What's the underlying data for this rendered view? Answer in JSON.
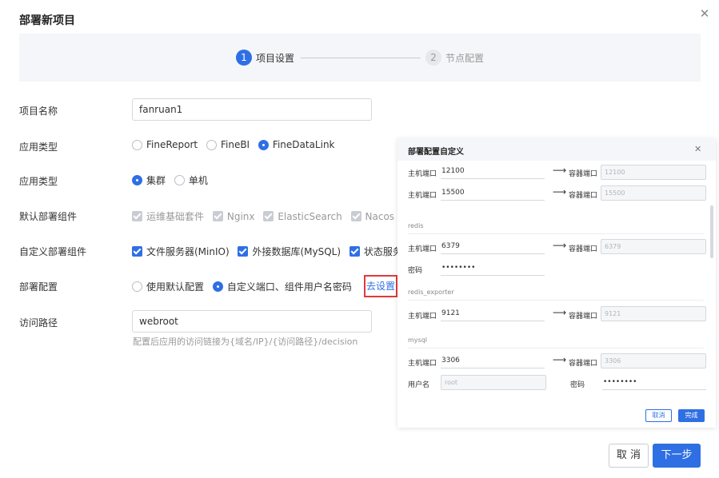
{
  "dialog": {
    "title": "部署新项目"
  },
  "steps": [
    {
      "num": "1",
      "label": "项目设置"
    },
    {
      "num": "2",
      "label": "节点配置"
    }
  ],
  "form": {
    "project_name": {
      "label": "项目名称",
      "value": "fanruan1"
    },
    "app_type": {
      "label": "应用类型",
      "options": [
        "FineReport",
        "FineBI",
        "FineDataLink"
      ],
      "selected": "FineDataLink"
    },
    "deploy_mode": {
      "label": "应用类型",
      "options": [
        "集群",
        "单机"
      ],
      "selected": "集群"
    },
    "default_components": {
      "label": "默认部署组件",
      "options": [
        "运维基础套件",
        "Nginx",
        "ElasticSearch",
        "Nacos"
      ]
    },
    "custom_components": {
      "label": "自定义部署组件",
      "options": [
        "文件服务器(MinIO)",
        "外接数据库(MySQL)",
        "状态服务器"
      ]
    },
    "deploy_config": {
      "label": "部署配置",
      "options": [
        "使用默认配置",
        "自定义端口、组件用户名密码"
      ],
      "selected": "自定义端口、组件用户名密码",
      "link": "去设置"
    },
    "access_path": {
      "label": "访问路径",
      "value": "webroot",
      "hint": "配置后应用的访问链接为{域名/IP}/{访问路径}/decision"
    }
  },
  "panel": {
    "title": "部署配置自定义",
    "host_port_label": "主机端口",
    "container_port_label": "容器端口",
    "rows1": [
      {
        "host": "12100",
        "container": "12100"
      },
      {
        "host": "15500",
        "container": "15500"
      }
    ],
    "redis": {
      "section": "redis",
      "host": "6379",
      "container": "6379",
      "password_label": "密码",
      "password": "••••••••"
    },
    "redis_exporter": {
      "section": "redis_exporter",
      "host": "9121",
      "container": "9121"
    },
    "mysql": {
      "section": "mysql",
      "host": "3306",
      "container": "3306",
      "username_label": "用户名",
      "username_placeholder": "root",
      "password_label": "密码",
      "password": "••••••••"
    },
    "cancel": "取消",
    "done": "完成"
  },
  "footer": {
    "cancel": "取 消",
    "next": "下一步"
  },
  "colors": {
    "primary": "#2f6fe4",
    "highlight": "#e03a3a"
  }
}
